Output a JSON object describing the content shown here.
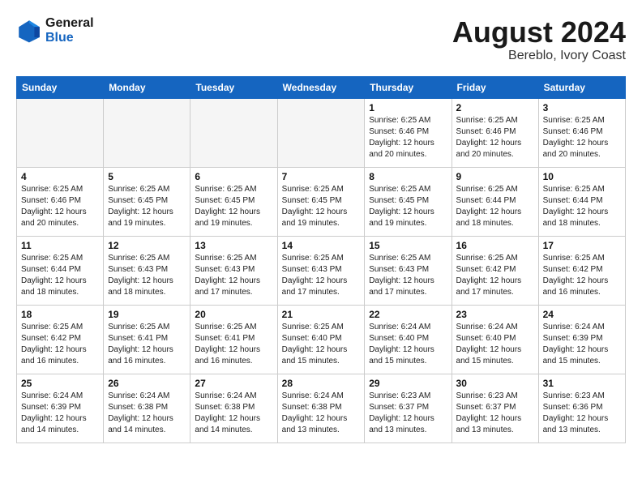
{
  "logo": {
    "line1": "General",
    "line2": "Blue"
  },
  "title": "August 2024",
  "subtitle": "Bereblo, Ivory Coast",
  "headers": [
    "Sunday",
    "Monday",
    "Tuesday",
    "Wednesday",
    "Thursday",
    "Friday",
    "Saturday"
  ],
  "weeks": [
    [
      {
        "day": "",
        "info": ""
      },
      {
        "day": "",
        "info": ""
      },
      {
        "day": "",
        "info": ""
      },
      {
        "day": "",
        "info": ""
      },
      {
        "day": "1",
        "info": "Sunrise: 6:25 AM\nSunset: 6:46 PM\nDaylight: 12 hours\nand 20 minutes."
      },
      {
        "day": "2",
        "info": "Sunrise: 6:25 AM\nSunset: 6:46 PM\nDaylight: 12 hours\nand 20 minutes."
      },
      {
        "day": "3",
        "info": "Sunrise: 6:25 AM\nSunset: 6:46 PM\nDaylight: 12 hours\nand 20 minutes."
      }
    ],
    [
      {
        "day": "4",
        "info": "Sunrise: 6:25 AM\nSunset: 6:46 PM\nDaylight: 12 hours\nand 20 minutes."
      },
      {
        "day": "5",
        "info": "Sunrise: 6:25 AM\nSunset: 6:45 PM\nDaylight: 12 hours\nand 19 minutes."
      },
      {
        "day": "6",
        "info": "Sunrise: 6:25 AM\nSunset: 6:45 PM\nDaylight: 12 hours\nand 19 minutes."
      },
      {
        "day": "7",
        "info": "Sunrise: 6:25 AM\nSunset: 6:45 PM\nDaylight: 12 hours\nand 19 minutes."
      },
      {
        "day": "8",
        "info": "Sunrise: 6:25 AM\nSunset: 6:45 PM\nDaylight: 12 hours\nand 19 minutes."
      },
      {
        "day": "9",
        "info": "Sunrise: 6:25 AM\nSunset: 6:44 PM\nDaylight: 12 hours\nand 18 minutes."
      },
      {
        "day": "10",
        "info": "Sunrise: 6:25 AM\nSunset: 6:44 PM\nDaylight: 12 hours\nand 18 minutes."
      }
    ],
    [
      {
        "day": "11",
        "info": "Sunrise: 6:25 AM\nSunset: 6:44 PM\nDaylight: 12 hours\nand 18 minutes."
      },
      {
        "day": "12",
        "info": "Sunrise: 6:25 AM\nSunset: 6:43 PM\nDaylight: 12 hours\nand 18 minutes."
      },
      {
        "day": "13",
        "info": "Sunrise: 6:25 AM\nSunset: 6:43 PM\nDaylight: 12 hours\nand 17 minutes."
      },
      {
        "day": "14",
        "info": "Sunrise: 6:25 AM\nSunset: 6:43 PM\nDaylight: 12 hours\nand 17 minutes."
      },
      {
        "day": "15",
        "info": "Sunrise: 6:25 AM\nSunset: 6:43 PM\nDaylight: 12 hours\nand 17 minutes."
      },
      {
        "day": "16",
        "info": "Sunrise: 6:25 AM\nSunset: 6:42 PM\nDaylight: 12 hours\nand 17 minutes."
      },
      {
        "day": "17",
        "info": "Sunrise: 6:25 AM\nSunset: 6:42 PM\nDaylight: 12 hours\nand 16 minutes."
      }
    ],
    [
      {
        "day": "18",
        "info": "Sunrise: 6:25 AM\nSunset: 6:42 PM\nDaylight: 12 hours\nand 16 minutes."
      },
      {
        "day": "19",
        "info": "Sunrise: 6:25 AM\nSunset: 6:41 PM\nDaylight: 12 hours\nand 16 minutes."
      },
      {
        "day": "20",
        "info": "Sunrise: 6:25 AM\nSunset: 6:41 PM\nDaylight: 12 hours\nand 16 minutes."
      },
      {
        "day": "21",
        "info": "Sunrise: 6:25 AM\nSunset: 6:40 PM\nDaylight: 12 hours\nand 15 minutes."
      },
      {
        "day": "22",
        "info": "Sunrise: 6:24 AM\nSunset: 6:40 PM\nDaylight: 12 hours\nand 15 minutes."
      },
      {
        "day": "23",
        "info": "Sunrise: 6:24 AM\nSunset: 6:40 PM\nDaylight: 12 hours\nand 15 minutes."
      },
      {
        "day": "24",
        "info": "Sunrise: 6:24 AM\nSunset: 6:39 PM\nDaylight: 12 hours\nand 15 minutes."
      }
    ],
    [
      {
        "day": "25",
        "info": "Sunrise: 6:24 AM\nSunset: 6:39 PM\nDaylight: 12 hours\nand 14 minutes."
      },
      {
        "day": "26",
        "info": "Sunrise: 6:24 AM\nSunset: 6:38 PM\nDaylight: 12 hours\nand 14 minutes."
      },
      {
        "day": "27",
        "info": "Sunrise: 6:24 AM\nSunset: 6:38 PM\nDaylight: 12 hours\nand 14 minutes."
      },
      {
        "day": "28",
        "info": "Sunrise: 6:24 AM\nSunset: 6:38 PM\nDaylight: 12 hours\nand 13 minutes."
      },
      {
        "day": "29",
        "info": "Sunrise: 6:23 AM\nSunset: 6:37 PM\nDaylight: 12 hours\nand 13 minutes."
      },
      {
        "day": "30",
        "info": "Sunrise: 6:23 AM\nSunset: 6:37 PM\nDaylight: 12 hours\nand 13 minutes."
      },
      {
        "day": "31",
        "info": "Sunrise: 6:23 AM\nSunset: 6:36 PM\nDaylight: 12 hours\nand 13 minutes."
      }
    ]
  ]
}
